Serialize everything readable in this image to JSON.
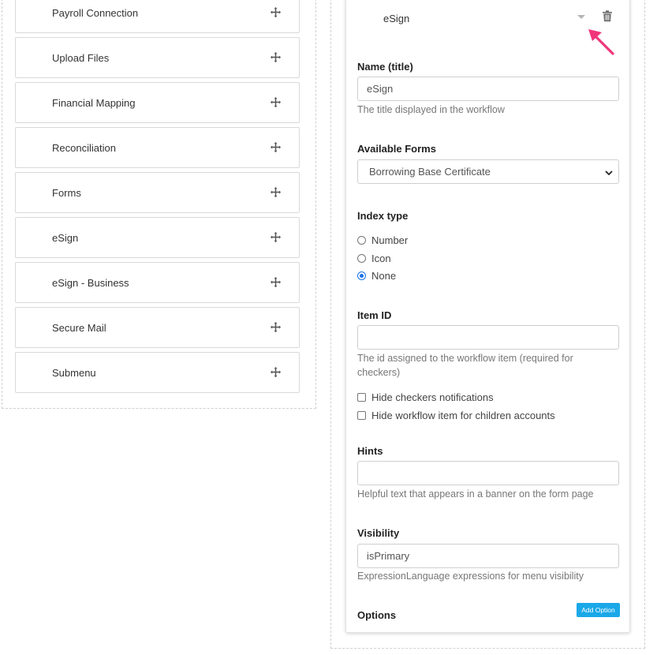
{
  "menu_items": [
    {
      "label": "Payroll Connection"
    },
    {
      "label": "Upload Files"
    },
    {
      "label": "Financial Mapping"
    },
    {
      "label": "Reconciliation"
    },
    {
      "label": "Forms"
    },
    {
      "label": "eSign"
    },
    {
      "label": "eSign - Business"
    },
    {
      "label": "Secure Mail"
    },
    {
      "label": "Submenu"
    }
  ],
  "icons": {
    "move": "move-arrows-icon",
    "collapse": "caret-down-icon",
    "delete": "trash-icon",
    "select": "chevron-down-icon"
  },
  "editor": {
    "title": "eSign",
    "name": {
      "label": "Name (title)",
      "value": "eSign",
      "help": "The title displayed in the workflow"
    },
    "forms": {
      "label": "Available Forms",
      "selected": "Borrowing Base Certificate"
    },
    "index_type": {
      "label": "Index type",
      "options": [
        {
          "label": "Number",
          "checked": false
        },
        {
          "label": "Icon",
          "checked": false
        },
        {
          "label": "None",
          "checked": true
        }
      ]
    },
    "item_id": {
      "label": "Item ID",
      "value": "",
      "help": "The id assigned to the workflow item (required for checkers)"
    },
    "checkboxes": [
      {
        "label": "Hide checkers notifications",
        "checked": false
      },
      {
        "label": "Hide workflow item for children accounts",
        "checked": false
      }
    ],
    "hints": {
      "label": "Hints",
      "value": "",
      "help": "Helpful text that appears in a banner on the form page"
    },
    "visibility": {
      "label": "Visibility",
      "value": "isPrimary",
      "help": "ExpressionLanguage expressions for menu visibility"
    },
    "options": {
      "label": "Options",
      "add_label": "Add Option"
    }
  },
  "colors": {
    "accent": "#1aa8e8",
    "radio_checked": "#1a73e8",
    "pointer_arrow": "#f0357a"
  }
}
